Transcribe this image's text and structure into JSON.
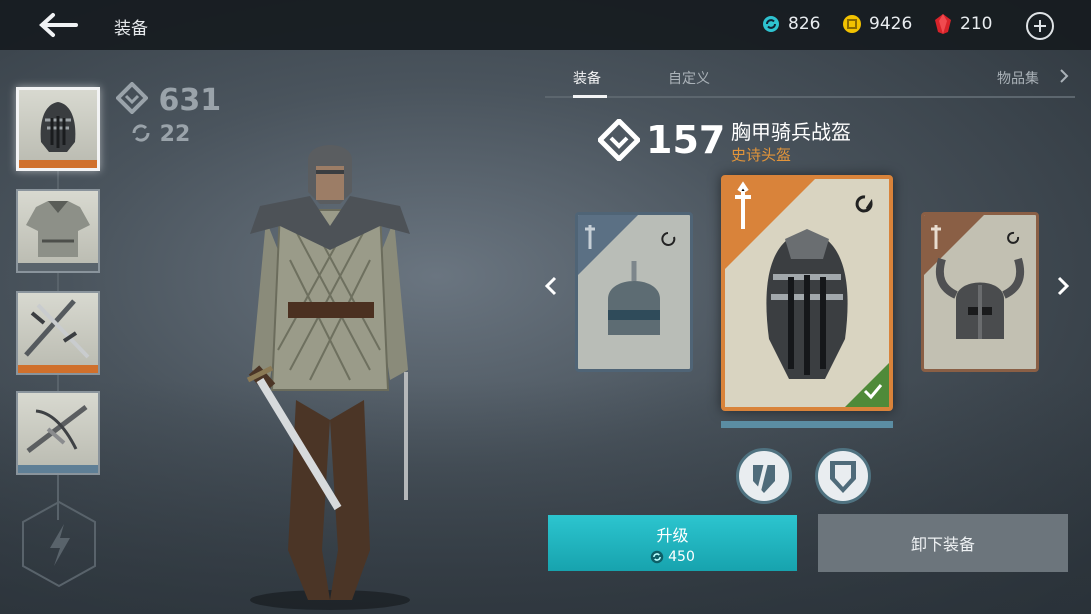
{
  "header": {
    "title": "装备",
    "currencies": [
      {
        "name": "blue-gem",
        "value": "826",
        "color": "#2ec2cf"
      },
      {
        "name": "gold-coin",
        "value": "9426",
        "color": "#f2c200"
      },
      {
        "name": "ruby",
        "value": "210",
        "color": "#d8232a"
      }
    ]
  },
  "character": {
    "power": "631",
    "upgrade_level": "22"
  },
  "slots": [
    {
      "name": "helmet",
      "bar_color": "#d0702c"
    },
    {
      "name": "armor",
      "bar_color": "#5a646c"
    },
    {
      "name": "melee-weapon",
      "bar_color": "#d0702c"
    },
    {
      "name": "ranged-weapon",
      "bar_color": "#5f7f96"
    }
  ],
  "tabs": {
    "equip": "装备",
    "customize": "自定义",
    "sets": "物品集"
  },
  "item": {
    "power": "157",
    "name": "胸甲骑兵战盔",
    "type": "史诗头盔",
    "type_color": "#e3953a"
  },
  "actions": {
    "upgrade_label": "升级",
    "upgrade_cost": "450",
    "unequip_label": "卸下装备"
  }
}
